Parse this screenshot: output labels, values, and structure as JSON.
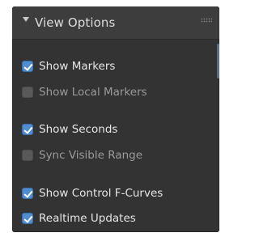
{
  "panel": {
    "title": "View Options",
    "collapse_icon": "triangle-down-icon",
    "grip_icon": "grip-dots-icon"
  },
  "options": [
    {
      "label": "Show Markers",
      "checked": true
    },
    {
      "label": "Show Local Markers",
      "checked": false
    },
    {
      "label": "Show Seconds",
      "checked": true
    },
    {
      "label": "Sync Visible Range",
      "checked": false
    },
    {
      "label": "Show Control F-Curves",
      "checked": true
    },
    {
      "label": "Realtime Updates",
      "checked": true
    }
  ],
  "colors": {
    "panel_bg": "#333333",
    "header_bg": "#3d3d3d",
    "checkbox_on": "#4f8cd0",
    "checkbox_off": "#595959",
    "text_active": "#e6e6e6",
    "text_inactive": "#9a9a9a"
  }
}
